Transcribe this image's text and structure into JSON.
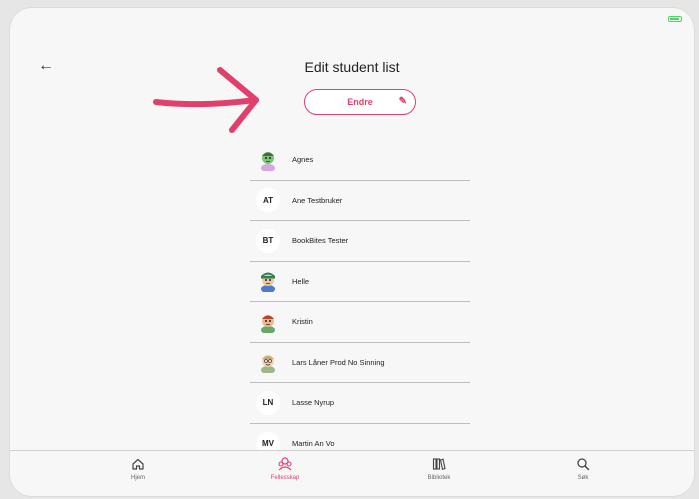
{
  "header": {
    "title": "Edit student list",
    "edit_button_label": "Endre"
  },
  "students": [
    {
      "name": "Agnes",
      "avatar": "character-green-girl",
      "initials": ""
    },
    {
      "name": "Ane Testbruker",
      "avatar": "initials",
      "initials": "AT"
    },
    {
      "name": "BookBites Tester",
      "avatar": "initials",
      "initials": "BT"
    },
    {
      "name": "Helle",
      "avatar": "character-blue",
      "initials": ""
    },
    {
      "name": "Kristin",
      "avatar": "character-green",
      "initials": ""
    },
    {
      "name": "Lars Låner Prod No Sinning",
      "avatar": "character-tan",
      "initials": ""
    },
    {
      "name": "Lasse Nyrup",
      "avatar": "initials",
      "initials": "LN"
    },
    {
      "name": "Martin An Vo",
      "avatar": "initials",
      "initials": "MV"
    }
  ],
  "tabs": [
    {
      "label": "Hjem",
      "icon": "home-icon",
      "active": false
    },
    {
      "label": "Fellesskap",
      "icon": "community-icon",
      "active": true
    },
    {
      "label": "Bibliotek",
      "icon": "library-icon",
      "active": false
    },
    {
      "label": "Søk",
      "icon": "search-icon",
      "active": false
    }
  ],
  "colors": {
    "accent": "#e0406c",
    "background": "#f7f7f7",
    "divider": "#bdbdbd"
  }
}
